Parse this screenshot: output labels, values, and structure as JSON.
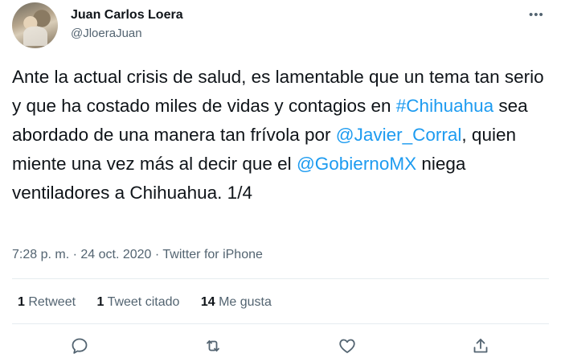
{
  "author": {
    "name": "Juan Carlos Loera",
    "handle": "@JloeraJuan"
  },
  "tweet": {
    "text_1": "Ante la actual crisis de salud, es lamentable que un tema tan serio y que ha costado miles de vidas y contagios en ",
    "hashtag": "#Chihuahua",
    "text_2": " sea abordado de una manera tan frívola por ",
    "mention_1": "@Javier_Corral",
    "text_3": ", quien miente una vez más al decir que el ",
    "mention_2": "@GobiernoMX",
    "text_4": " niega ventiladores a Chihuahua. 1/4"
  },
  "meta": {
    "time": "7:28 p. m.",
    "sep1": " · ",
    "date": "24 oct. 2020",
    "sep2": " · ",
    "source": "Twitter for iPhone"
  },
  "stats": {
    "retweets_count": "1",
    "retweets_label": " Retweet",
    "quotes_count": "1",
    "quotes_label": " Tweet citado",
    "likes_count": "14",
    "likes_label": " Me gusta"
  },
  "icons": {
    "more": "more-icon",
    "reply": "reply-icon",
    "retweet": "retweet-icon",
    "like": "like-icon",
    "share": "share-icon"
  },
  "colors": {
    "link": "#1d9bf0",
    "secondary_text": "#536471",
    "primary_text": "#0f1419",
    "divider": "#e6ecf0"
  }
}
